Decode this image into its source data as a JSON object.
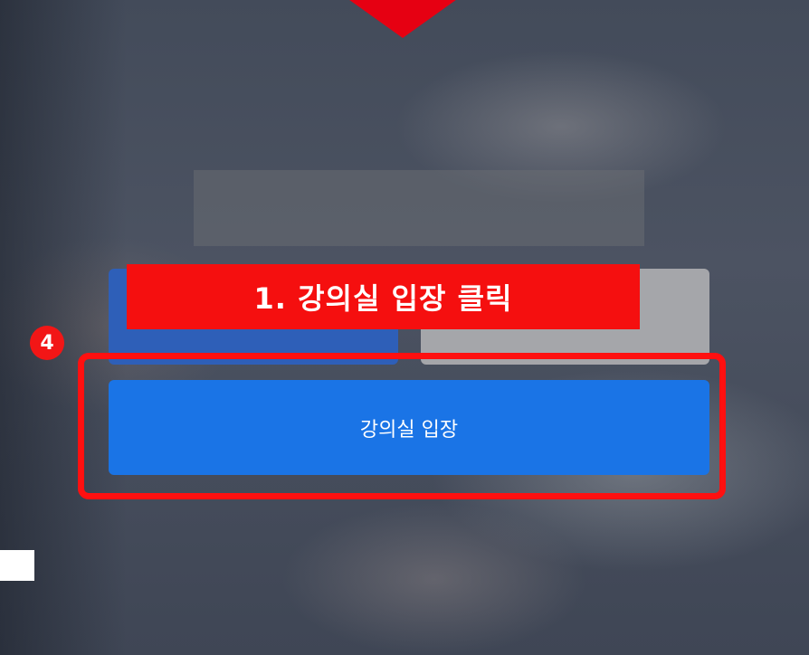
{
  "background": {
    "description_icon": "laptop-hands-photo"
  },
  "tutorial": {
    "callout_text": "1. 강의실 입장 클릭",
    "step_badge": "4",
    "accent_color": "#f50f0f"
  },
  "buttons": {
    "enter_classroom_label": "강의실 입장",
    "enter_color": "#1a74e6",
    "login_color": "#2e5fb8",
    "signup_color": "#a5a6aa"
  }
}
